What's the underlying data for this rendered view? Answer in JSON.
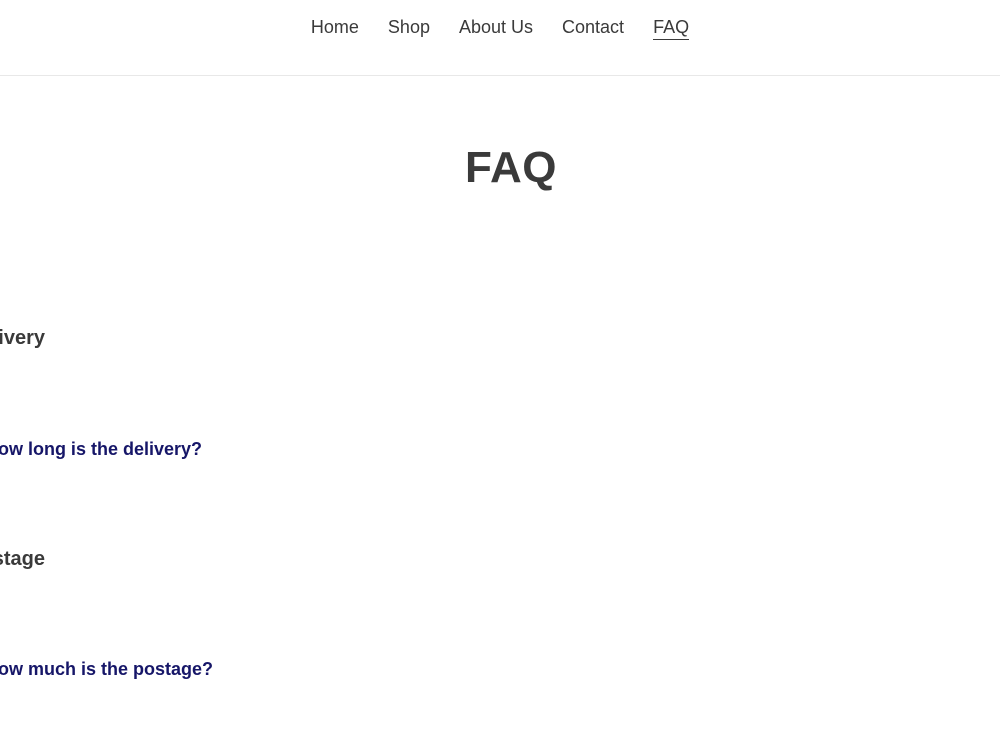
{
  "nav": {
    "items": [
      {
        "label": "Home"
      },
      {
        "label": "Shop"
      },
      {
        "label": "About Us"
      },
      {
        "label": "Contact"
      },
      {
        "label": "FAQ",
        "active": true
      }
    ]
  },
  "page_title": "FAQ",
  "faq": {
    "sections": [
      {
        "heading": "Delivery",
        "questions": [
          {
            "question": "How long is the delivery?"
          }
        ]
      },
      {
        "heading": "Postage",
        "questions": [
          {
            "question": "How much is the postage?"
          }
        ]
      }
    ]
  },
  "colors": {
    "text": "#3a3a3a",
    "question_link": "#161668",
    "border": "#e8e8e8",
    "background": "#ffffff"
  }
}
